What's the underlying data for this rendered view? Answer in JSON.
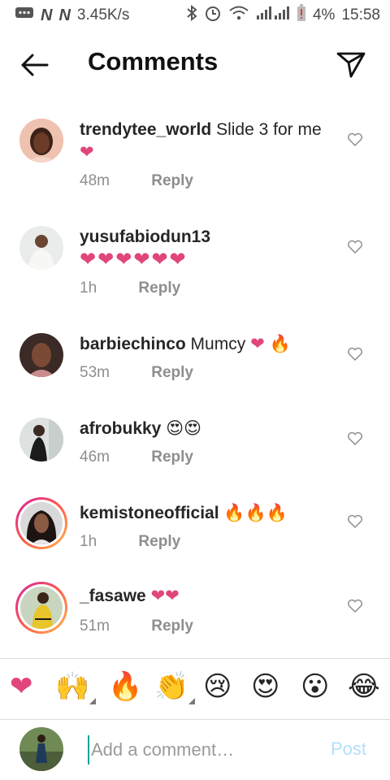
{
  "status": {
    "speed": "3.45K/s",
    "battery": "4%",
    "time": "15:58"
  },
  "header": {
    "title": "Comments"
  },
  "comments": [
    {
      "user": "trendytee_world",
      "text": "Slide 3 for me",
      "emoji": "❤",
      "time": "48m",
      "reply": "Reply"
    },
    {
      "user": "yusufabiodun13",
      "text": "",
      "emoji": "❤❤❤❤❤❤",
      "time": "1h",
      "reply": "Reply"
    },
    {
      "user": "barbiechinco",
      "text": "Mumcy",
      "emoji": "❤ 🔥",
      "time": "53m",
      "reply": "Reply"
    },
    {
      "user": "afrobukky",
      "text": "",
      "emoji": "😍😍",
      "time": "46m",
      "reply": "Reply"
    },
    {
      "user": "kemistoneofficial",
      "text": "",
      "emoji": "🔥🔥🔥",
      "time": "1h",
      "reply": "Reply"
    },
    {
      "user": "_fasawe",
      "text": "",
      "emoji": "❤❤",
      "time": "51m",
      "reply": "Reply"
    }
  ],
  "emoji_bar": [
    "❤",
    "🙌",
    "🔥",
    "👏",
    "😢",
    "😍",
    "😮",
    "😂"
  ],
  "composer": {
    "placeholder": "Add a comment…",
    "post_label": "Post"
  }
}
